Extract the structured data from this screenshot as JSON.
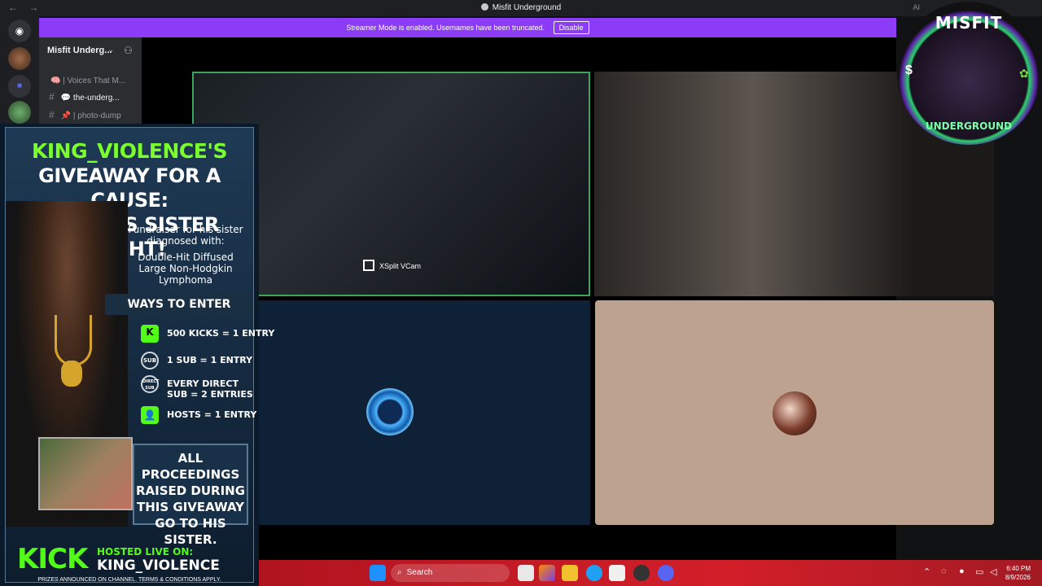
{
  "window": {
    "title": "Misfit Underground",
    "nav_back": "←",
    "nav_forward": "→",
    "ai_label": "AI"
  },
  "banner": {
    "text": "Streamer Mode is enabled. Usernames have been truncated.",
    "button": "Disable"
  },
  "sidebar": {
    "server_name": "Misfit Underg...",
    "channels": [
      {
        "label": "| Voices That M...",
        "emoji": "🧠"
      },
      {
        "label": "the-underg...",
        "emoji": "💬"
      },
      {
        "label": "| photo-dump",
        "emoji": "📌"
      }
    ]
  },
  "video": {
    "vcam_label": "XSplit VCam"
  },
  "logo": {
    "top_text": "MISFIT",
    "bottom_text": "UNDERGROUND",
    "dollar": "$"
  },
  "promo": {
    "title_line1": "KING_VIOLENCE'S",
    "title_line2": "GIVEAWAY FOR A CAUSE:",
    "title_line3": "HELP HIS SISTER FIGHT!",
    "fund_line1": "Fundraiser for his sister diagnosed with:",
    "fund_line2": "Double-Hit Diffused Large Non-Hodgkin Lymphoma",
    "ways_heading": "WAYS TO ENTER",
    "entries": [
      {
        "icon": "K",
        "text": "500 KICKS = 1 ENTRY"
      },
      {
        "icon": "SUB",
        "text": "1 SUB = 1 ENTRY"
      },
      {
        "icon": "DIRECT SUB",
        "text": "EVERY DIRECT SUB = 2 ENTRIES"
      },
      {
        "icon": "👤",
        "text": "HOSTS = 1 ENTRY"
      }
    ],
    "proceeds": "ALL PROCEEDINGS RAISED DURING THIS GIVEAWAY GO TO HIS SISTER.",
    "kick_word": "KICK",
    "hosted_label": "HOSTED LIVE ON:",
    "hosted_name": "KING_VIOLENCE",
    "prizes_note": "PRIZES ANNOUNCED ON CHANNEL. TERMS & CONDITIONS APPLY."
  },
  "taskbar": {
    "search": "Search",
    "time": "6:40 PM",
    "date": "8/9/2026",
    "colors": {
      "bar": "#d21f2a"
    }
  }
}
